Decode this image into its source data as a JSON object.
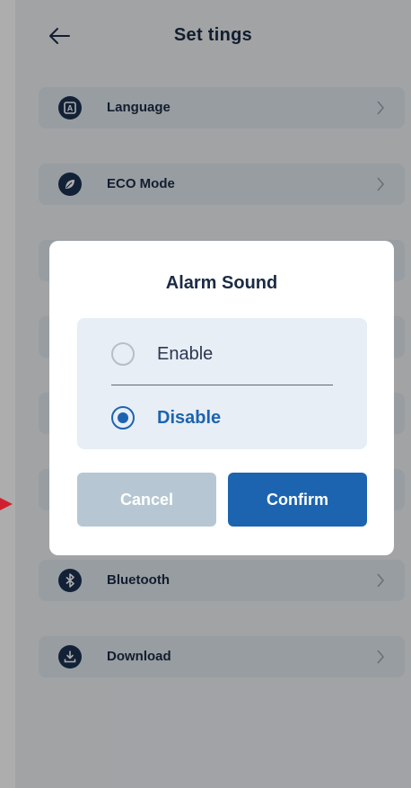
{
  "header": {
    "title": "Set tings"
  },
  "settings": {
    "items": [
      {
        "label": "Language"
      },
      {
        "label": "ECO Mode"
      },
      {
        "label": ""
      },
      {
        "label": ""
      },
      {
        "label": ""
      },
      {
        "label": ""
      },
      {
        "label": "Bluetooth"
      },
      {
        "label": "Download"
      }
    ]
  },
  "dialog": {
    "title": "Alarm Sound",
    "options": [
      {
        "label": "Enable",
        "selected": false
      },
      {
        "label": "Disable",
        "selected": true
      }
    ],
    "cancel_label": "Cancel",
    "confirm_label": "Confirm"
  },
  "colors": {
    "accent": "#1c64b0",
    "title_text": "#1b2b44",
    "cancel_button": "#b6c7d3",
    "marker": "#d0202f"
  },
  "icons": {
    "back": "arrow-left-icon",
    "language": "letter-a-icon",
    "eco": "leaf-icon",
    "bluetooth": "bluetooth-icon",
    "download": "download-icon",
    "chevron": "chevron-right-icon"
  }
}
